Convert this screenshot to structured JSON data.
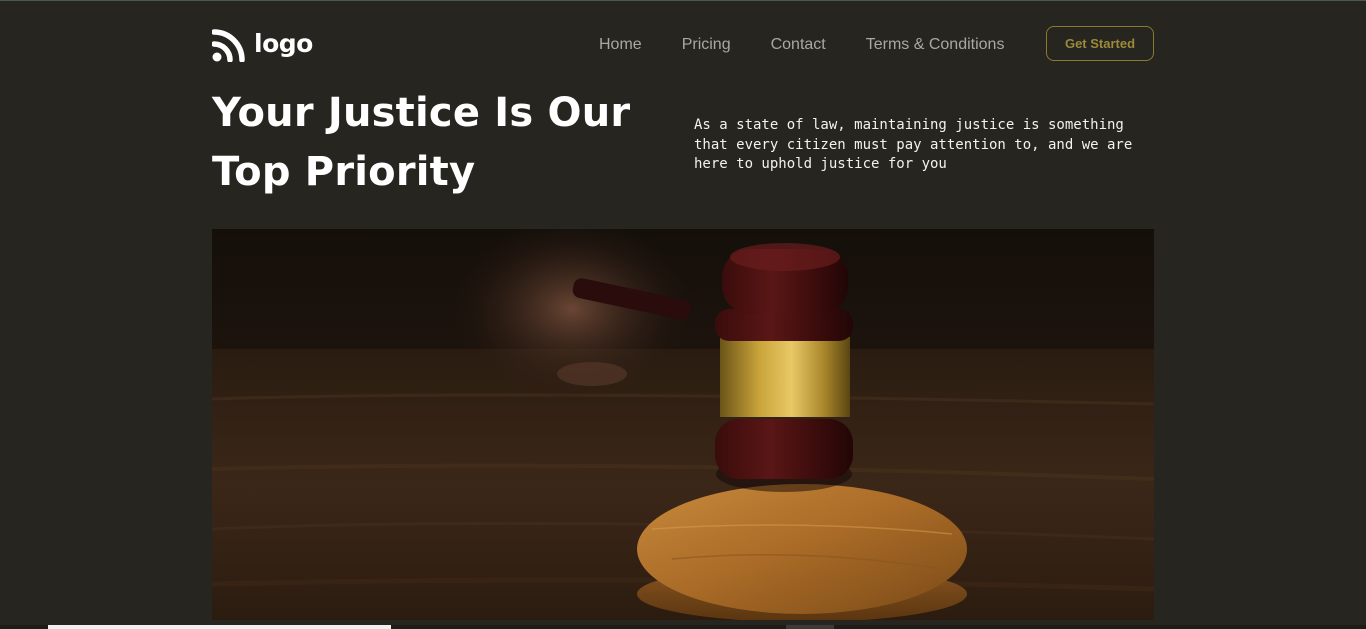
{
  "brand": {
    "logo_text": "logo",
    "logo_icon": "rss-feed-icon"
  },
  "nav": {
    "items": [
      {
        "label": "Home"
      },
      {
        "label": "Pricing"
      },
      {
        "label": "Contact"
      },
      {
        "label": "Terms & Conditions"
      }
    ],
    "cta_label": "Get Started"
  },
  "hero": {
    "title": "Your Justice Is Our Top Priority",
    "description": "As a state of law, maintaining justice is something that every citizen must pay attention to, and we are here to uphold justice for you",
    "image_subject": "judge-gavel-photo"
  },
  "colors": {
    "background": "#27251f",
    "accent": "#9a8a3a",
    "nav_text": "#a8a8a4",
    "heading": "#ffffff"
  }
}
